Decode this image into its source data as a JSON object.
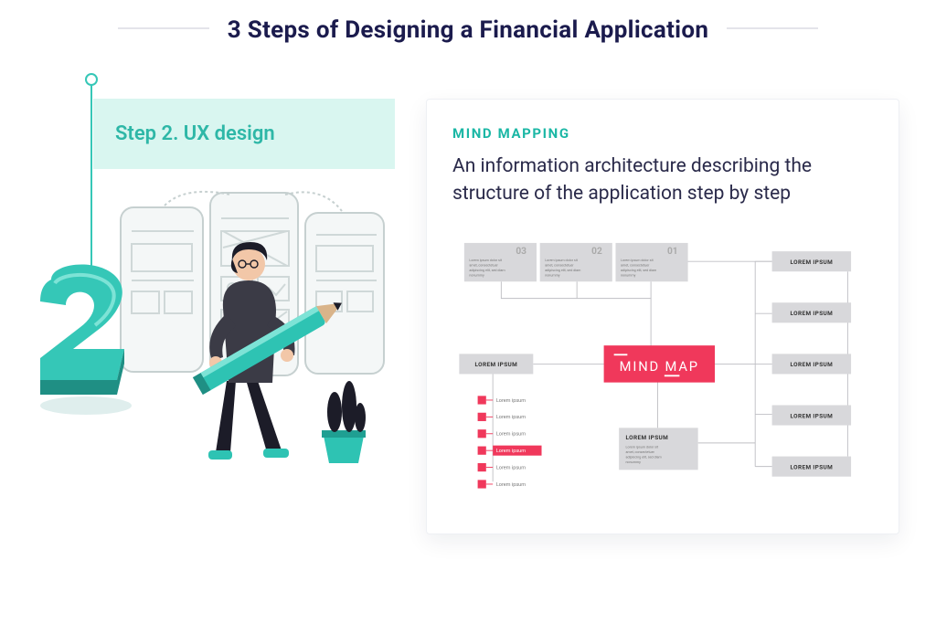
{
  "header": {
    "title": "3 Steps of Designing a Financial Application"
  },
  "left": {
    "step_label": "Step 2. UX design",
    "number": "2"
  },
  "right": {
    "eyebrow": "MIND MAPPING",
    "description": "An information architecture describing the structure of the application step by step"
  },
  "mindmap": {
    "center": "MIND MAP",
    "top_nodes": [
      {
        "num": "03",
        "title": "Lorem ipsum dolor sit",
        "sub": "amet, consectetuer adipiscing elit, sed diam nonummy"
      },
      {
        "num": "02",
        "title": "Lorem ipsum dolor sit",
        "sub": "amet, consectetuer adipiscing elit, sed diam nonummy"
      },
      {
        "num": "01",
        "title": "Lorem ipsum dolor sit",
        "sub": "amet, consectetuer adipiscing elit, sed diam nonummy"
      }
    ],
    "right_nodes": [
      "LOREM IPSUM",
      "LOREM IPSUM",
      "LOREM IPSUM",
      "LOREM IPSUM",
      "LOREM IPSUM"
    ],
    "left_node": "LOREM IPSUM",
    "bottom_node": {
      "title": "LOREM IPSUM",
      "sub": "Lorem ipsum dolor sit amet, consectetuer adipiscing elit, sed diam nonummy"
    },
    "bullets": [
      "Lorem ipsum",
      "Lorem ipsum",
      "Lorem ipsum",
      "Lorem ipsum",
      "Lorem ipsum",
      "Lorem ipsum"
    ],
    "bullet_highlight_index": 3
  }
}
